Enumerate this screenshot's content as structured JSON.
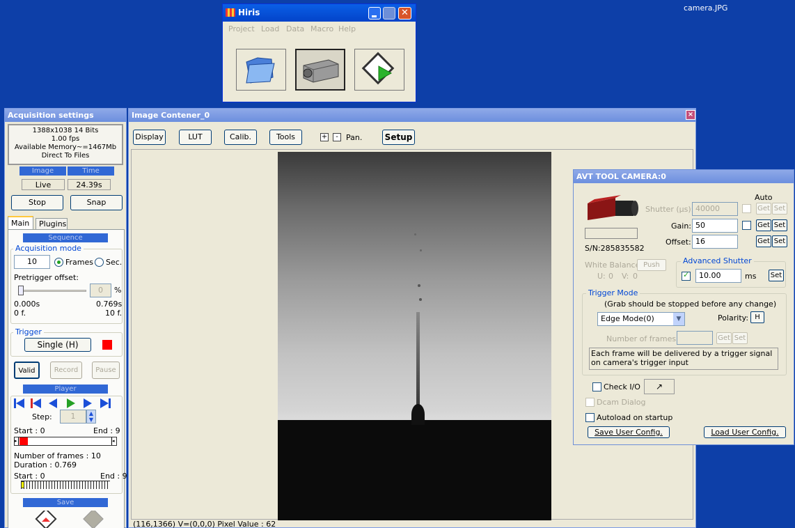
{
  "desktop": {
    "file_label": "camera.JPG"
  },
  "hiris": {
    "title": "Hiris",
    "menu": [
      "Project",
      "Load",
      "Data",
      "Macro",
      "Help"
    ],
    "tools": [
      {
        "icon": "folder-icon"
      },
      {
        "icon": "camera-icon"
      },
      {
        "icon": "video-play-icon"
      }
    ]
  },
  "acq": {
    "title": "Acquisition settings",
    "info": [
      "1388x1038 14 Bits",
      "1.00 fps",
      "Available Memory~=1467Mb",
      "Direct To Files"
    ],
    "image_header": "Image",
    "time_header": "Time",
    "image_value": "Live",
    "time_value": "24.39s",
    "stop_label": "Stop",
    "snap_label": "Snap",
    "tabs": [
      "Main",
      "Plugins"
    ],
    "sequence_header": "Sequence",
    "acq_mode_title": "Acquisition mode",
    "frames_value": "10",
    "frames_radio": "Frames",
    "sec_radio": "Sec.",
    "pretrigger_label": "Pretrigger offset:",
    "pretrigger_value": "0",
    "percent": "%",
    "range_left_time": "0.000s",
    "range_right_time": "0.769s",
    "range_left_frames": "0 f.",
    "range_right_frames": "10 f.",
    "trigger_title": "Trigger",
    "trigger_button": "Single (H)",
    "valid_label": "Valid",
    "record_label": "Record",
    "pause_label": "Pause",
    "player_header": "Player",
    "step_label": "Step:",
    "step_value": "1",
    "start1": "Start : 0",
    "end1": "End : 9",
    "num_frames": "Number of frames : 10",
    "duration": "Duration : 0.769",
    "start2": "Start : 0",
    "end2": "End : 9",
    "save_header": "Save"
  },
  "image": {
    "title": "Image Contener_0",
    "toolbar": [
      "Display",
      "LUT",
      "Calib.",
      "Tools"
    ],
    "plus": "+",
    "minus": "-",
    "pan": "Pan.",
    "setup": "Setup",
    "status": "(116,1366) V=(0,0,0)  Pixel Value : 62"
  },
  "avt": {
    "title": "AVT TOOL CAMERA:0",
    "auto": "Auto",
    "shutter_label": "Shutter (µs):",
    "shutter_value": "40000",
    "gain_label": "Gain:",
    "gain_value": "50",
    "offset_label": "Offset:",
    "offset_value": "16",
    "get": "Get",
    "set": "Set",
    "sn": "S/N:285835582",
    "wb_label": "White Balance:",
    "push": "Push",
    "u": "U:",
    "u_val": "0",
    "v": "V:",
    "v_val": "0",
    "adv_title": "Advanced Shutter",
    "adv_value": "10.00",
    "adv_unit": "ms",
    "trig_title": "Trigger Mode",
    "trig_note": "(Grab should be stopped before any change)",
    "edge_mode": "Edge Mode(0)",
    "polarity_label": "Polarity:",
    "polarity_value": "H",
    "num_frames_label": "Number of frames :",
    "desc": "Each frame will be delivered by a trigger signal on camera's trigger input",
    "check_io": "Check I/O",
    "io_symbol": "↗",
    "dcam": "Dcam Dialog",
    "autoload": "Autoload on startup",
    "save_cfg": "Save User Config.",
    "load_cfg": "Load User Config."
  }
}
